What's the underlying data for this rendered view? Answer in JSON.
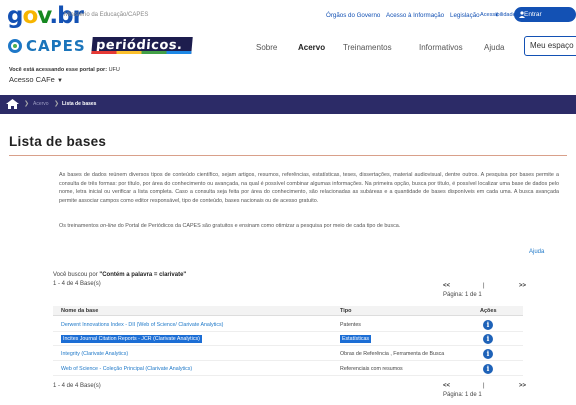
{
  "gov": {
    "logo_parts": [
      "g",
      "o",
      "v",
      ".br"
    ],
    "ministry": "Ministério da Educação/CAPES",
    "links": [
      "Órgãos do Governo",
      "Acesso à Informação",
      "Legislação",
      "Acessibilidade"
    ],
    "login_label": "Entrar"
  },
  "nav": {
    "capes_logo": "CAPES",
    "periodicos_logo": "periódicos.",
    "items": [
      "Sobre",
      "Acervo",
      "Treinamentos",
      "Informativos",
      "Ajuda"
    ],
    "meu_espaco": "Meu espaço"
  },
  "access": {
    "label": "Você está acessando esse portal por:",
    "institution": "UFU",
    "cafe": "Acesso CAFe"
  },
  "breadcrumb": {
    "items": [
      "Acervo",
      "Lista de bases"
    ]
  },
  "page": {
    "title": "Lista de bases",
    "intro": "As bases de dados reúnem diversos tipos de conteúdo científico, sejam artigos, resumos, referências, estatísticas, teses, dissertações, material audiovisual, dentre outros. A pesquisa por bases permite a consulta de três formas: por título, por área do conhecimento ou avançada, na qual é possível combinar algumas informações. Na primeira opção, busca por título, é possível localizar uma base de dados pelo nome, letra inicial ou verificar a lista completa. Caso a consulta seja feita por área do conhecimento, são relacionadas as subáreas e a quantidade de bases disponíveis em cada uma. A busca avançada permite associar campos como editor responsável, tipo de conteúdo, bases nacionais ou de acesso gratuito.",
    "training_pre": "Os treinamentos ",
    "training_em": "on-line",
    "training_post": " do Portal de Periódicos da CAPES são gratuitos e ensinam como otimizar a pesquisa por meio de cada tipo de busca.",
    "help": "Ajuda"
  },
  "results": {
    "searched_pre": "Você buscou por ",
    "searched_query": "\"Contém a palavra = clarivate\"",
    "count": "1 - 4 de 4 Base(s)",
    "pager_prev": "<<",
    "pager_sep": "|",
    "pager_next": ">>",
    "page_label": "Página: 1 de 1",
    "columns": [
      "Nome da base",
      "Tipo",
      "Ações"
    ],
    "rows": [
      {
        "name": "Derwent Innovations Index - DII (Web of Science/ Clarivate Analytics)",
        "type": "Patentes"
      },
      {
        "name": "Incites Journal Citation Reports - JCR (Clarivate Analytics)",
        "type": "Estatísticas"
      },
      {
        "name": "Integrity (Clarivate Analytics)",
        "type": "Obras de Referência , Ferramenta de Busca"
      },
      {
        "name": "Web of Science - Coleção Principal (Clarivate Analytics)",
        "type": "Referenciais com resumos"
      }
    ],
    "info_icon": "i"
  },
  "colors": {
    "gov_blue": "#1351b4",
    "breadcrumb_bg": "#2c2b67",
    "link": "#1e78c8",
    "highlight": "#1c6ed5"
  }
}
